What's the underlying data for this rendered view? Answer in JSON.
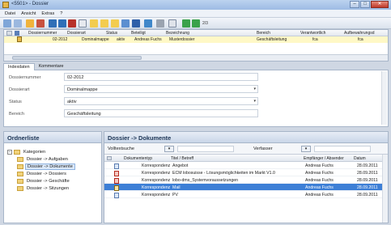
{
  "window": {
    "title": "<5501> - Dossier",
    "buttons": {
      "minimize": "–",
      "maximize": "□",
      "close": "✕"
    }
  },
  "menu": [
    "Datei",
    "Ansicht",
    "Extras",
    "?"
  ],
  "toolbar": {
    "page_indicator": "2/3"
  },
  "dossier_grid": {
    "headers": [
      "Dossiernummer",
      "Dossierart",
      "Status",
      "Beteiligt",
      "Bezeichnung",
      "Bereich",
      "Verantwortlich",
      "Aufbewahrungsd"
    ],
    "row": [
      "02-2012",
      "Dominalmappe",
      "aktiv",
      "Andreas Fuchs",
      "Musterdossier",
      "Geschäftsleitung",
      "fca",
      "fca"
    ]
  },
  "tabs": [
    "Indexdaten",
    "Kommentare"
  ],
  "form": [
    {
      "label": "Dossiernummer",
      "value": "02-2012",
      "dropdown": false
    },
    {
      "label": "Dossierart",
      "value": "Dominalmappe",
      "dropdown": true
    },
    {
      "label": "Status",
      "value": "aktiv",
      "dropdown": true
    },
    {
      "label": "Bereich",
      "value": "Geschäftsleitung",
      "dropdown": false
    }
  ],
  "left_panel": {
    "title": "Ordnerliste",
    "tree": {
      "root": "Kategorien",
      "items": [
        "Dossier -> Aufgaben",
        "Dossier -> Dokumente",
        "Dossier -> Dossiers",
        "Dossier -> Geschäfte",
        "Dossier -> Sitzungen"
      ],
      "selected": 1
    }
  },
  "right_panel": {
    "title": "Dossier -> Dokumente",
    "filter": {
      "volltext_label": "Volltextsuche",
      "verfasser_label": "Verfasser"
    },
    "headers": [
      "Dokumententyp",
      "Titel / Betreff",
      "Empfänger / Absender",
      "Datum"
    ],
    "rows": [
      {
        "type": "Korrespondenz",
        "title": "Angebot",
        "party": "Andreas Fuchs",
        "date": "28.09.2011",
        "icon": "word-document-icon"
      },
      {
        "type": "Korrespondenz",
        "title": "ECM lobosuisse - Lösungsmöglichkeiten im Markt V1.0",
        "party": "Andreas Fuchs",
        "date": "28.09.2011",
        "icon": "pdf-document-icon"
      },
      {
        "type": "Korrespondenz",
        "title": "lobo-dms_Systemvoraussetzungen",
        "party": "Andreas Fuchs",
        "date": "28.09.2011",
        "icon": "pdf-document-icon"
      },
      {
        "type": "Korrespondenz",
        "title": "Mail",
        "party": "Andreas Fuchs",
        "date": "28.09.2011",
        "icon": "mail-document-icon"
      },
      {
        "type": "Korrespondenz",
        "title": "PV",
        "party": "Andreas Fuchs",
        "date": "28.09.2011",
        "icon": "word-document-icon"
      }
    ],
    "selected_row": 3
  },
  "colors": {
    "selection": "#3d7fd6",
    "panel_header": "#c9d6e8",
    "row_highlight": "#fff8c6"
  }
}
